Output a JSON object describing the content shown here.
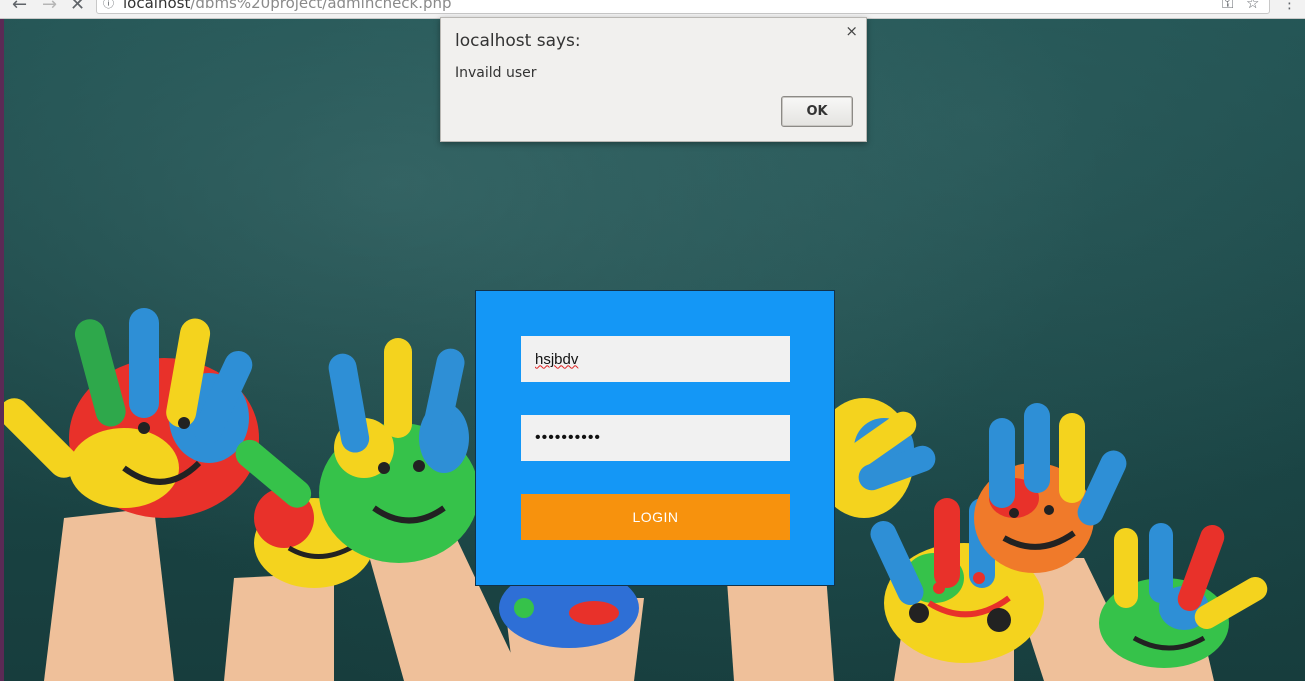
{
  "browser": {
    "url_host": "localhost",
    "url_path": "/dbms%20project/admincheck.php"
  },
  "alert": {
    "title": "localhost says:",
    "message": "Invaild user",
    "ok_label": "OK",
    "close_glyph": "×"
  },
  "login": {
    "username_value": "hsjbdv",
    "password_mask": "••••••••••",
    "button_label": "LOGIN"
  },
  "colors": {
    "panel": "#1497f6",
    "button": "#f7920d",
    "board": "#1e4a4a"
  },
  "icons": {
    "back": "back-arrow-icon",
    "forward": "forward-arrow-icon",
    "reload": "stop-icon",
    "info": "info-icon",
    "key": "key-icon",
    "star": "bookmark-star-icon",
    "menu": "menu-dots-icon"
  }
}
